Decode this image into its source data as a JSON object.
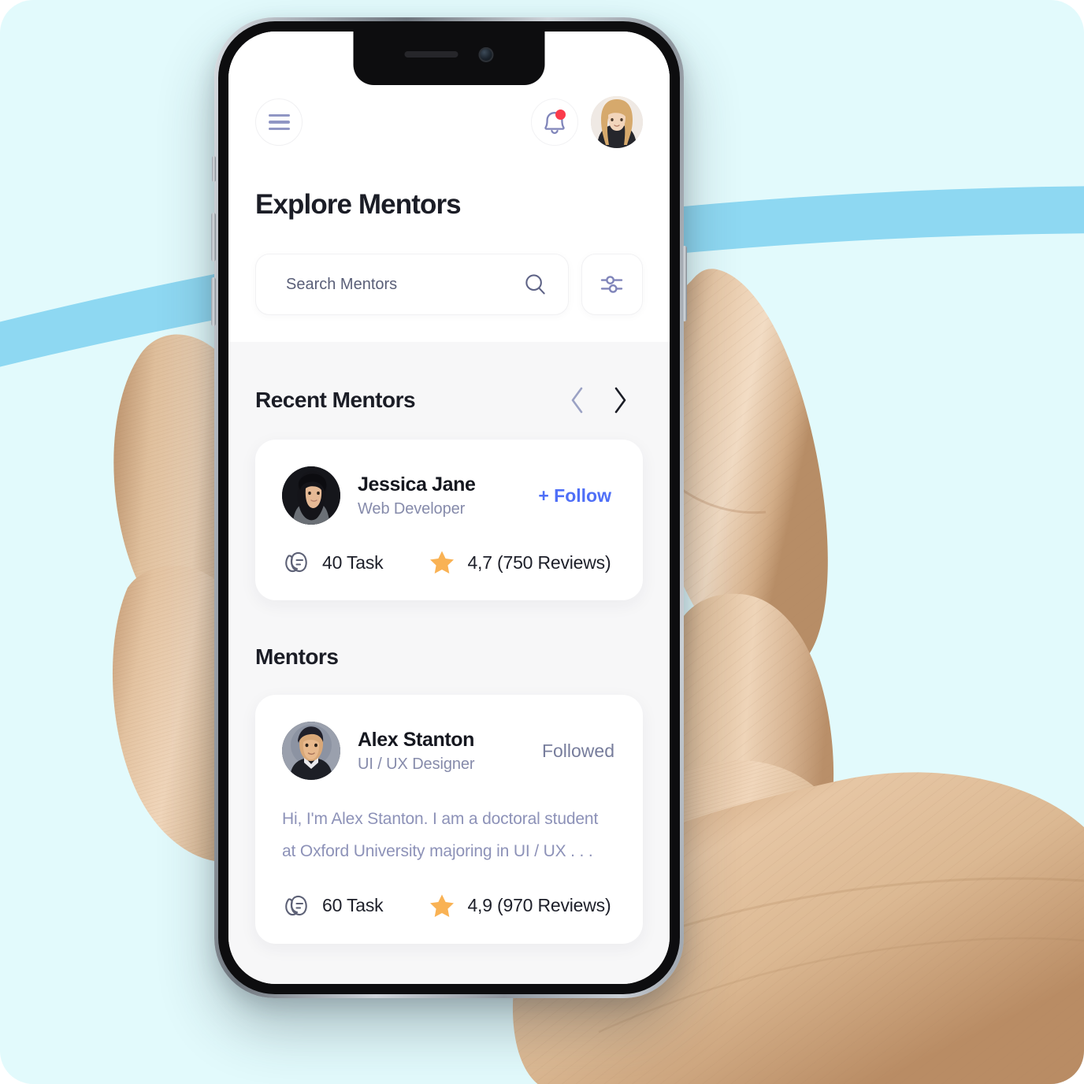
{
  "header": {
    "menu_icon": "hamburger-menu-icon",
    "bell_icon": "notification-bell-icon",
    "has_notification": true,
    "avatar_label": "user-avatar"
  },
  "page": {
    "title": "Explore Mentors"
  },
  "search": {
    "placeholder": "Search Mentors",
    "value": "",
    "search_icon": "search-icon",
    "filter_icon": "filter-sliders-icon"
  },
  "recent_section": {
    "title": "Recent Mentors",
    "prev_icon": "chevron-left-icon",
    "next_icon": "chevron-right-icon"
  },
  "recent_mentor": {
    "name": "Jessica Jane",
    "role": "Web Developer",
    "action_label": "+ Follow",
    "task_count": "40 Task",
    "rating": "4,7 (750 Reviews)",
    "task_icon": "task-cards-icon",
    "star_icon": "star-icon"
  },
  "mentors_section": {
    "title": "Mentors"
  },
  "mentor": {
    "name": "Alex Stanton",
    "role": "UI / UX Designer",
    "action_label": "Followed",
    "bio": "Hi, I'm Alex Stanton. I am a doctoral student at Oxford University majoring in UI / UX  . . .",
    "task_count": "60 Task",
    "rating": "4,9 (970 Reviews)",
    "task_icon": "task-cards-icon",
    "star_icon": "star-icon"
  },
  "colors": {
    "background": "#e2fafc",
    "swoosh": "#8ed8f2",
    "accent_blue": "#4f6ff7",
    "star_orange": "#f9b254",
    "icon_purple": "#9096c4",
    "badge_red": "#fb3b4b",
    "text_dark": "#1b1d26",
    "text_muted": "#868bab"
  }
}
